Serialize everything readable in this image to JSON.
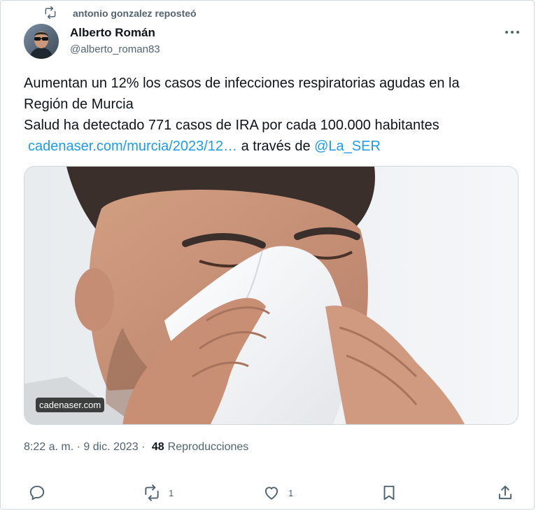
{
  "repost": {
    "label": "antonio gonzalez reposteó",
    "icon": "repost-icon"
  },
  "author": {
    "name": "Alberto Román",
    "handle": "@alberto_roman83",
    "avatar_icon": "avatar"
  },
  "tweet": {
    "line1": "Aumentan un 12% los casos de infecciones respiratorias agudas en la",
    "line2": "Región de Murcia",
    "line3": "Salud ha detectado 771 casos de IRA por cada 100.000 habitantes",
    "link_text": "cadenaser.com/murcia/2023/12…",
    "via_text": " a través de ",
    "mention": "@La_SER"
  },
  "media": {
    "source_label": "cadenaser.com"
  },
  "meta": {
    "time": "8:22 a. m.",
    "separator": " · ",
    "date": "9 dic. 2023",
    "views_count": "48",
    "views_label": "Reproducciones"
  },
  "actions": {
    "reply_icon": "reply-icon",
    "repost_count": "1",
    "like_count": "1",
    "bookmark_icon": "bookmark-icon",
    "share_icon": "share-icon"
  },
  "colors": {
    "text": "#0f1419",
    "secondary": "#536471",
    "link": "#1d9bf0",
    "border": "#cfd9de"
  }
}
